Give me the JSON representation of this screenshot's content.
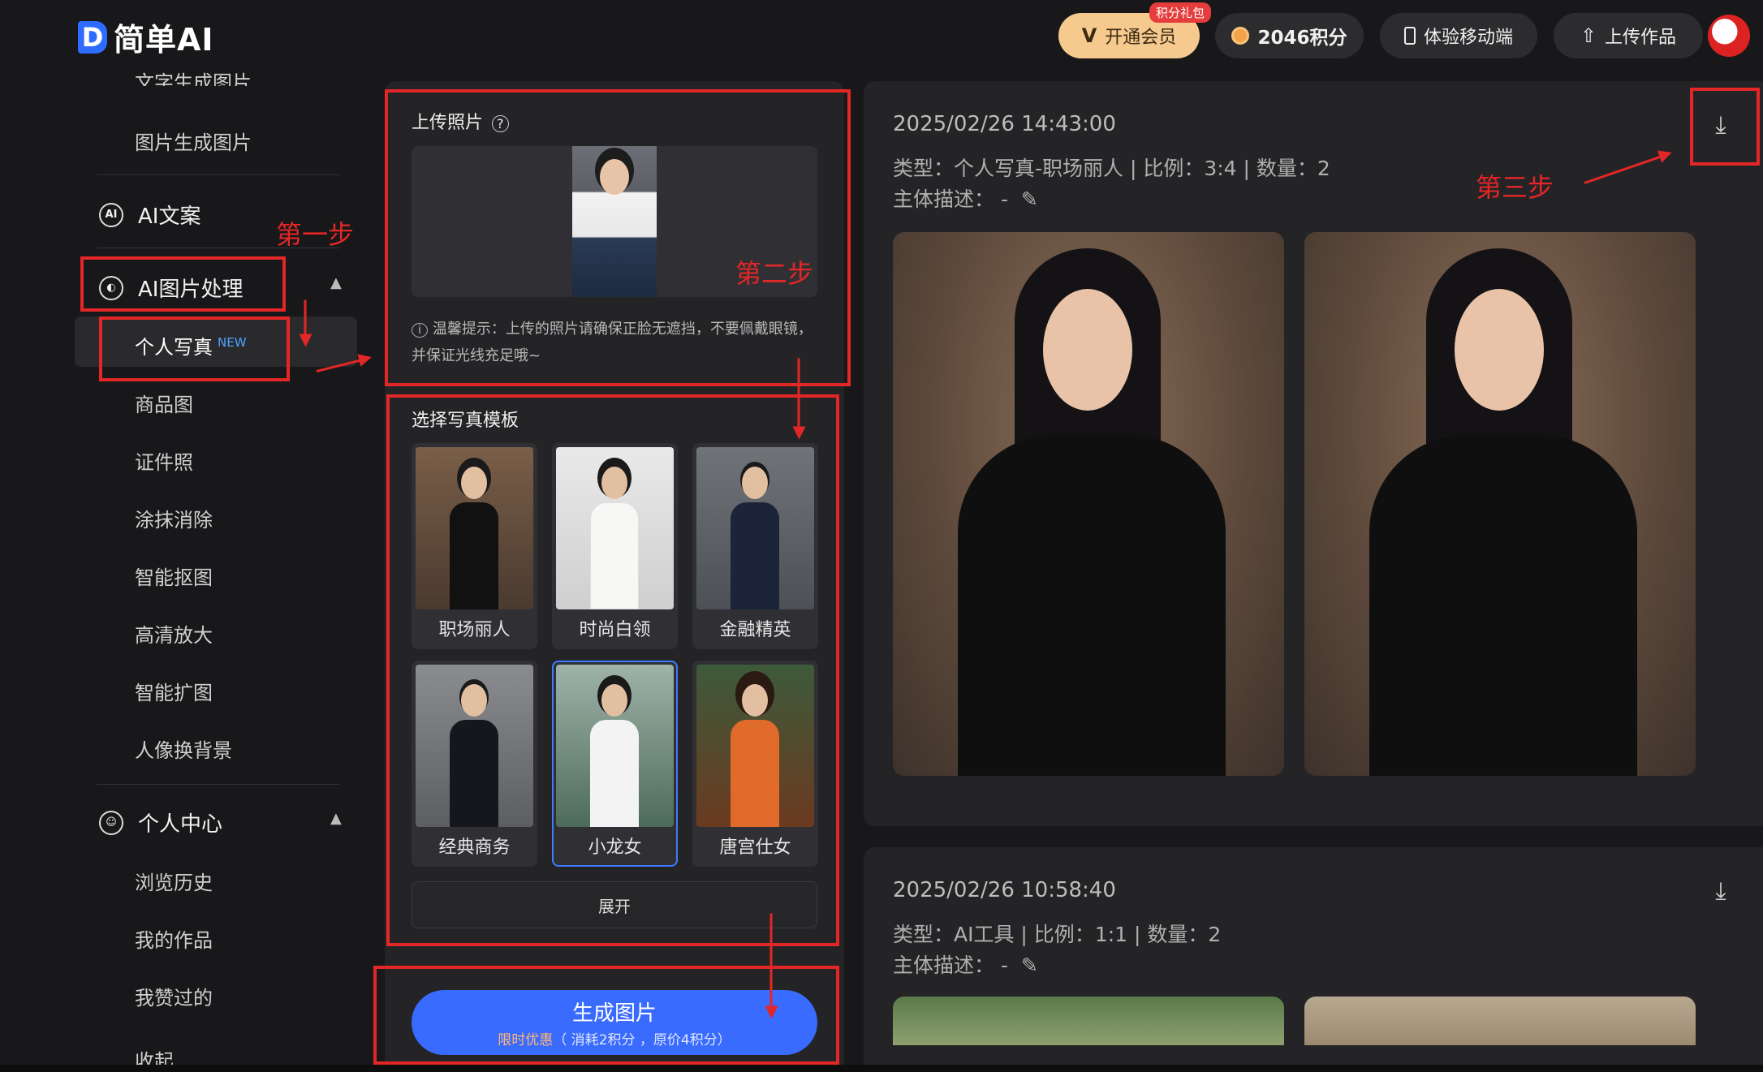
{
  "header": {
    "logo_text": "简单AI",
    "vip_label": "开通会员",
    "vip_badge": "积分礼包",
    "points_label": "2046积分",
    "mobile_label": "体验移动端",
    "upload_label": "上传作品"
  },
  "sidebar": {
    "partial_top": "文字生成图片",
    "img2img": "图片生成图片",
    "ai_copy": "AI文案",
    "ai_image": "AI图片处理",
    "items": [
      "个人写真",
      "商品图",
      "证件照",
      "涂抹消除",
      "智能抠图",
      "高清放大",
      "智能扩图",
      "人像换背景"
    ],
    "new_tag": "NEW",
    "personal_center": "个人中心",
    "personal_items": [
      "浏览历史",
      "我的作品",
      "我赞过的"
    ],
    "partial_bottom": "收起"
  },
  "middle": {
    "upload_title": "上传照片",
    "tip": "温馨提示：上传的照片请确保正脸无遮挡，不要佩戴眼镜，并保证光线充足哦~",
    "template_title": "选择写真模板",
    "templates": [
      "职场丽人",
      "时尚白领",
      "金融精英",
      "经典商务",
      "小龙女",
      "唐宫仕女"
    ],
    "expand_label": "展开",
    "generate_label": "生成图片",
    "generate_sub_hl": "限时优惠",
    "generate_sub": "（ 消耗2积分 ，原价4积分）"
  },
  "results": [
    {
      "date": "2025/02/26 14:43:00",
      "meta": "类型：个人写真-职场丽人 | 比例：3:4 | 数量：2",
      "desc": "主体描述： -"
    },
    {
      "date": "2025/02/26 10:58:40",
      "meta": "类型：AI工具 | 比例：1:1 | 数量：2",
      "desc": "主体描述： -"
    }
  ],
  "annotations": {
    "step1": "第一步",
    "step2": "第二步",
    "step3": "第三步",
    "color": "#e32626"
  }
}
